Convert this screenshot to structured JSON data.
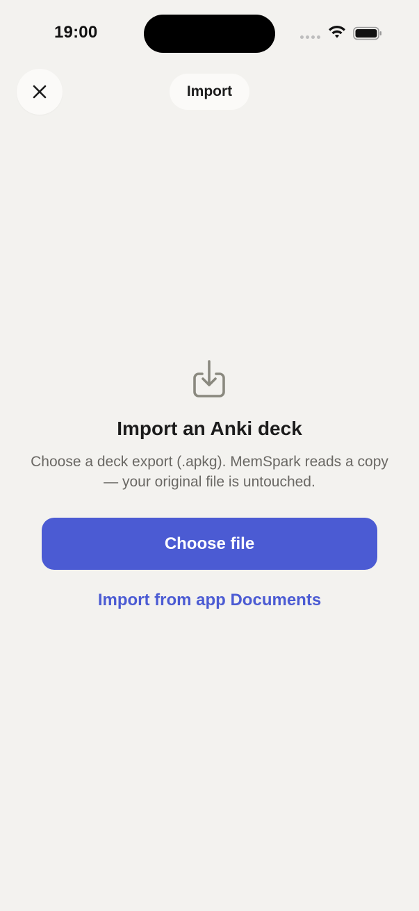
{
  "status_bar": {
    "time": "19:00"
  },
  "nav": {
    "close_icon": "xmark-icon",
    "title": "Import"
  },
  "empty_state": {
    "icon": "tray-arrow-down-icon",
    "heading": "Import an Anki deck",
    "description": "Choose a deck export (.apkg). MemSpark reads a copy — your original file is untouched.",
    "primary_button": "Choose file",
    "secondary_link": "Import from app Documents"
  },
  "colors": {
    "background": "#f3f2ef",
    "accent": "#4b5bd3",
    "icon_gray": "#8a897f",
    "description_text": "#6a6864"
  }
}
